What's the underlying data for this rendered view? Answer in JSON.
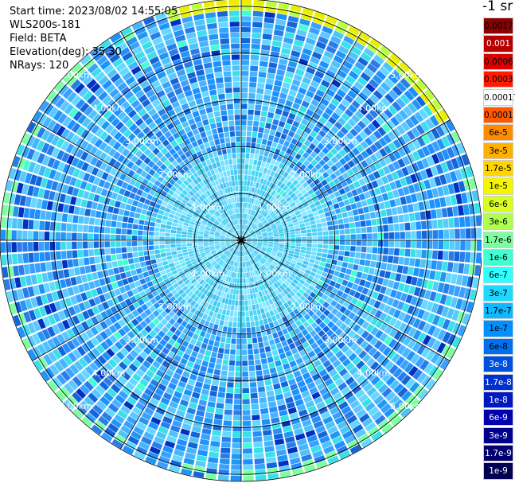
{
  "header": {
    "start_time": "Start time: 2023/08/02 14:55:05",
    "device": "WLS200s-181",
    "field": "Field: BETA",
    "elevation": "Elevation(deg): 35.30",
    "nrays": "NRays: 120"
  },
  "units": "-1 sr",
  "colorbar": {
    "labels": [
      "0.0017",
      "0.001",
      "0.0006",
      "0.0003",
      "0.00017",
      "0.0001",
      "6e-5",
      "3e-5",
      "1.7e-5",
      "1e-5",
      "6e-6",
      "3e-6",
      "1.7e-6",
      "1e-6",
      "6e-7",
      "3e-7",
      "1.7e-7",
      "1e-7",
      "6e-8",
      "3e-8",
      "1.7e-8",
      "1e-8",
      "6e-9",
      "3e-9",
      "1.7e-9",
      "1e-9"
    ],
    "colors": [
      "#8b0000",
      "#b80000",
      "#dd0000",
      "#ff1a00",
      "#ffffff",
      "#ff5a00",
      "#ff8c00",
      "#ffb000",
      "#ffd400",
      "#f5f500",
      "#d8ff20",
      "#b0ff50",
      "#7dffa0",
      "#40ffd0",
      "#30ffff",
      "#20d8ff",
      "#10b8ff",
      "#0090ff",
      "#0070f0",
      "#0050e0",
      "#0030d0",
      "#0018c0",
      "#0000b0",
      "#000090",
      "#000070",
      "#000050"
    ],
    "text_colors": [
      "#000",
      "#fff",
      "#000",
      "#000",
      "#000",
      "#000",
      "#000",
      "#000",
      "#000",
      "#000",
      "#000",
      "#000",
      "#000",
      "#000",
      "#000",
      "#000",
      "#000",
      "#000",
      "#000",
      "#fff",
      "#fff",
      "#fff",
      "#fff",
      "#fff",
      "#fff",
      "#fff"
    ]
  },
  "chart_data": {
    "type": "heatmap",
    "projection": "polar-ppi",
    "field": "BETA",
    "nrays": 120,
    "range_rings_km": [
      1,
      2,
      3,
      4,
      5
    ],
    "ring_labels": [
      "1.00km",
      "2.00km",
      "3.00km",
      "4.00km",
      "5.00km"
    ],
    "max_range_km": 5.15,
    "azimuth_lines_deg": [
      0,
      30,
      60,
      90,
      120,
      150,
      180,
      210,
      240,
      270,
      300,
      330
    ],
    "scale": "log",
    "dominant_value_range": [
      "1e-7",
      "1e-6"
    ],
    "edge_values": "up to 1e-5 near outer edge, north-east"
  }
}
